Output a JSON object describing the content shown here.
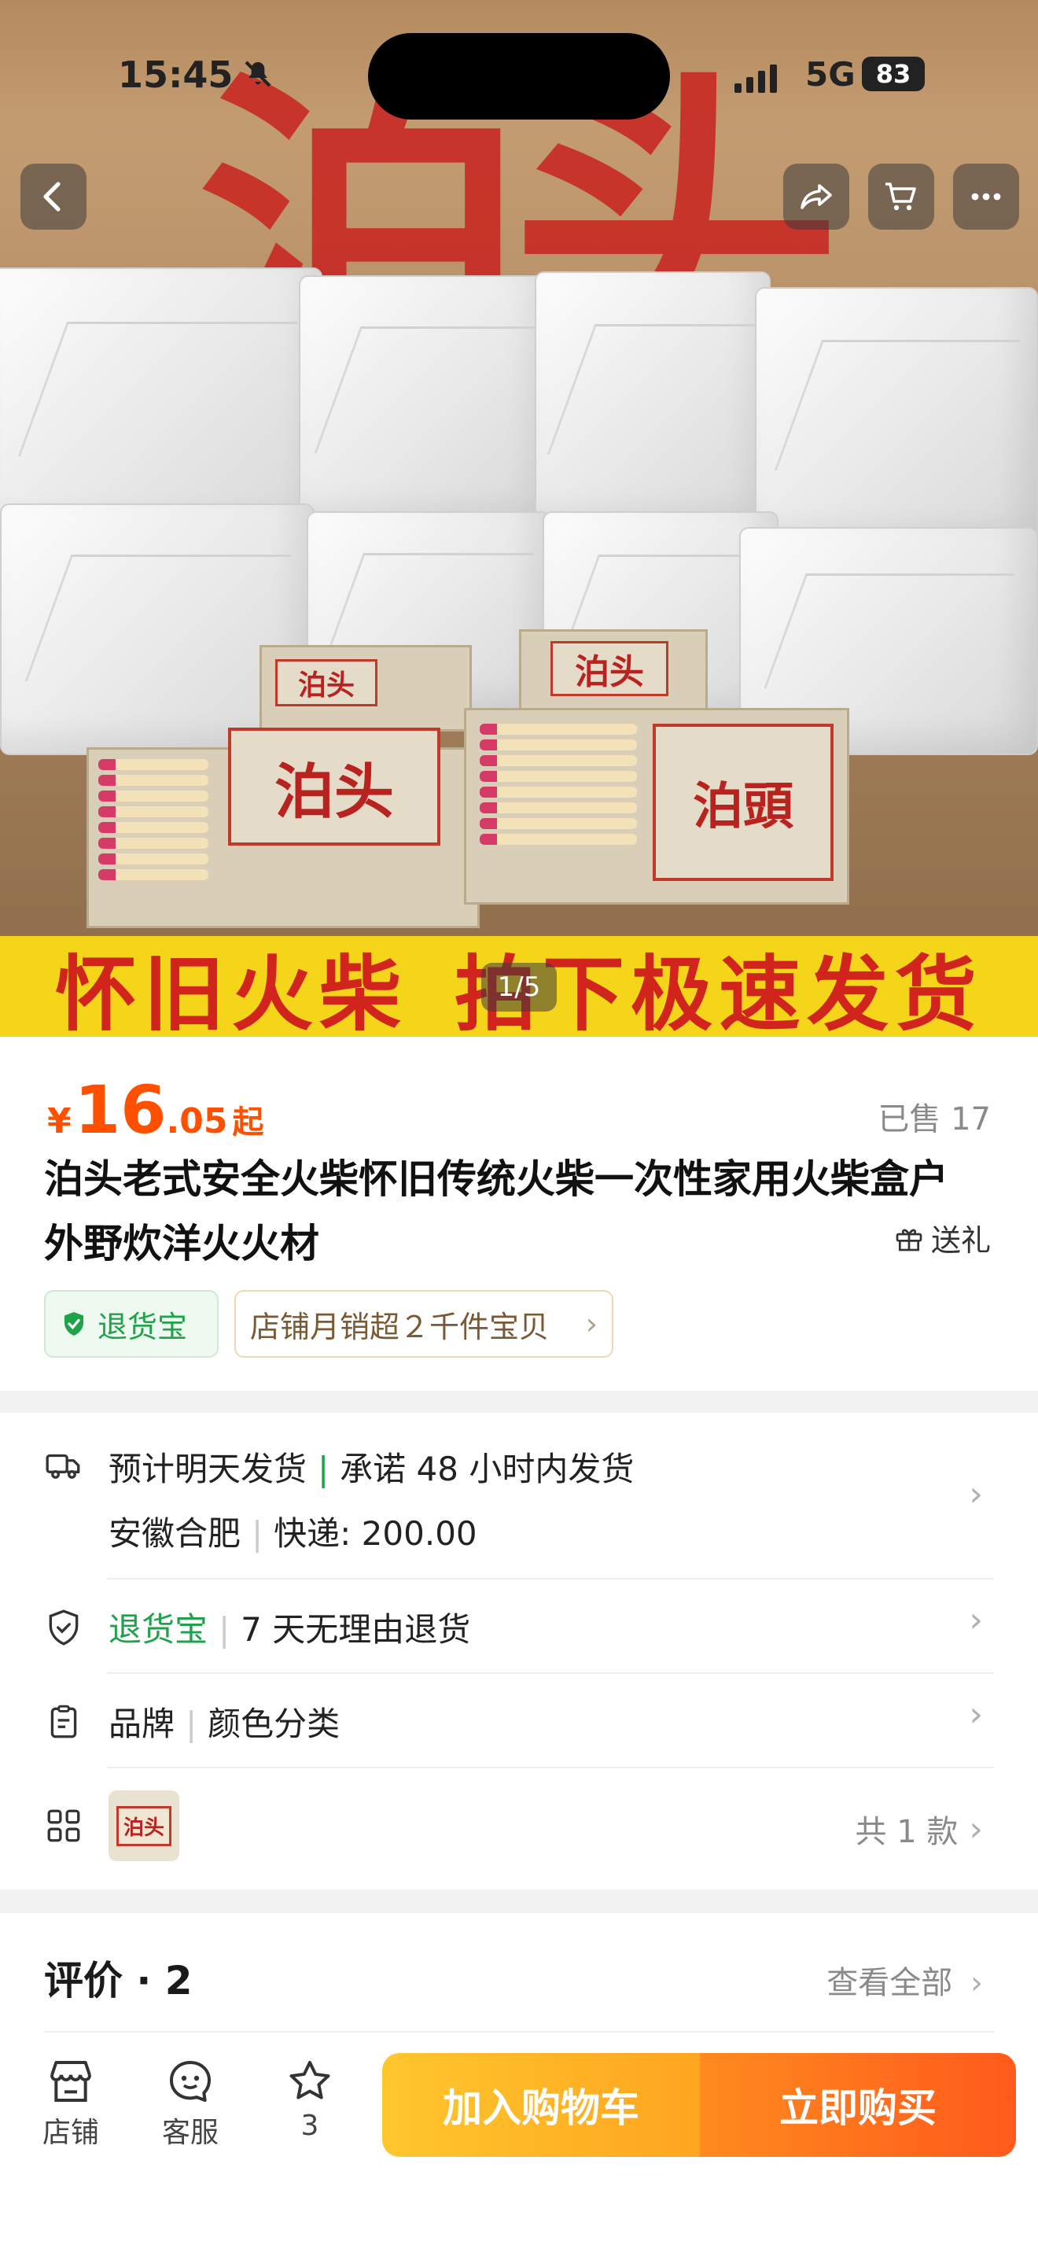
{
  "status_bar": {
    "time": "15:45",
    "network": "5G",
    "battery": "83"
  },
  "hero": {
    "page_indicator": "1/5",
    "banner_left": "怀旧火柴",
    "banner_right": "拍下极速发货",
    "brand_big": "泊头",
    "box_labels": [
      "泊头",
      "泊头",
      "泊头",
      "泊頭"
    ]
  },
  "product": {
    "price_currency": "¥",
    "price_int": "16",
    "price_dec": ".05",
    "price_suffix": "起",
    "sold": "已售 17",
    "title": "泊头老式安全火柴怀旧传统火柴一次性家用火柴盒户外野炊洋火火材",
    "gift": "送礼",
    "tags": {
      "return": "退货宝",
      "shop": "店铺月销超２千件宝贝"
    }
  },
  "services": {
    "shipping_estimate": "预计明天发货",
    "shipping_promise": "承诺 48 小时内发货",
    "origin": "安徽合肥",
    "express": "快递: 200.00",
    "return_label": "退货宝",
    "return_desc": "7 天无理由退货",
    "brand": "品牌",
    "color": "颜色分类",
    "sku_thumb": "泊头",
    "sku_count": "共 1 款"
  },
  "reviews": {
    "title": "评价 · 2",
    "see_all": "查看全部"
  },
  "bottom_bar": {
    "shop": "店铺",
    "service": "客服",
    "favorites": "3",
    "add_to_cart": "加入购物车",
    "buy_now": "立即购买"
  },
  "colors": {
    "accent": "#ff5000",
    "green": "#1fa24a",
    "cart": "#ffb020",
    "buy": "#ff6a1c"
  }
}
